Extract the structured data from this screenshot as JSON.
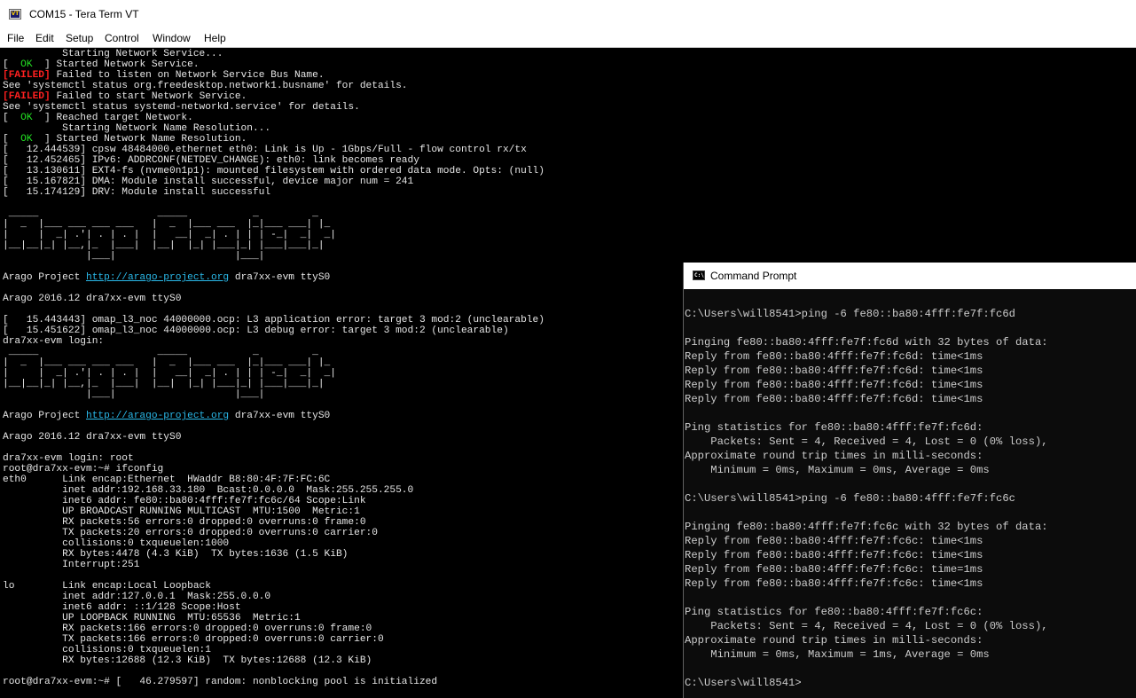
{
  "teraterm": {
    "title": "COM15 - Tera Term VT",
    "icon_label": "VT",
    "menu": [
      "File",
      "Edit",
      "Setup",
      "Control",
      "Window",
      "Help"
    ],
    "lines": [
      [
        {
          "t": "          Starting Network Service..."
        }
      ],
      [
        {
          "t": "[  "
        },
        {
          "t": "OK",
          "c": "ok"
        },
        {
          "t": "  ] Started Network Service."
        }
      ],
      [
        {
          "t": "[",
          "c": "failed"
        },
        {
          "t": "FAILED",
          "c": "failed"
        },
        {
          "t": "]",
          "c": "failed"
        },
        {
          "t": " Failed to listen on Network Service Bus Name."
        }
      ],
      [
        {
          "t": "See 'systemctl status org.freedesktop.network1.busname' for details."
        }
      ],
      [
        {
          "t": "[",
          "c": "failed"
        },
        {
          "t": "FAILED",
          "c": "failed"
        },
        {
          "t": "]",
          "c": "failed"
        },
        {
          "t": " Failed to start Network Service."
        }
      ],
      [
        {
          "t": "See 'systemctl status systemd-networkd.service' for details."
        }
      ],
      [
        {
          "t": "[  "
        },
        {
          "t": "OK",
          "c": "ok"
        },
        {
          "t": "  ] Reached target Network."
        }
      ],
      [
        {
          "t": "          Starting Network Name Resolution..."
        }
      ],
      [
        {
          "t": "[  "
        },
        {
          "t": "OK",
          "c": "ok"
        },
        {
          "t": "  ] Started Network Name Resolution."
        }
      ],
      [
        {
          "t": "[   12.444539] cpsw 48484000.ethernet eth0: Link is Up - 1Gbps/Full - flow control rx/tx"
        }
      ],
      [
        {
          "t": "[   12.452465] IPv6: ADDRCONF(NETDEV_CHANGE): eth0: link becomes ready"
        }
      ],
      [
        {
          "t": "[   13.130611] EXT4-fs (nvme0n1p1): mounted filesystem with ordered data mode. Opts: (null)"
        }
      ],
      [
        {
          "t": "[   15.167821] DMA: Module install successful, device major num = 241"
        }
      ],
      [
        {
          "t": "[   15.174129] DRV: Module install successful"
        }
      ],
      [
        {
          "t": ""
        }
      ],
      [
        {
          "t": " _____                    _____           _         _"
        }
      ],
      [
        {
          "t": "|  _  |___ ___ ___ ___   |  _  |___ ___  |_|___ ___| |_"
        }
      ],
      [
        {
          "t": "|     |  _| .'| . | . |  |   __|  _| . | | | -_|  _|  _|"
        }
      ],
      [
        {
          "t": "|__|__|_| |__,|_  |___|  |__|  |_| |___|_| |___|___|_|"
        }
      ],
      [
        {
          "t": "              |___|                    |___|"
        }
      ],
      [
        {
          "t": ""
        }
      ],
      [
        {
          "t": "Arago Project "
        },
        {
          "t": "http://arago-project.org",
          "c": "url"
        },
        {
          "t": " dra7xx-evm ttyS0"
        }
      ],
      [
        {
          "t": ""
        }
      ],
      [
        {
          "t": "Arago 2016.12 dra7xx-evm ttyS0"
        }
      ],
      [
        {
          "t": ""
        }
      ],
      [
        {
          "t": "[   15.443443] omap_l3_noc 44000000.ocp: L3 application error: target 3 mod:2 (unclearable)"
        }
      ],
      [
        {
          "t": "[   15.451622] omap_l3_noc 44000000.ocp: L3 debug error: target 3 mod:2 (unclearable)"
        }
      ],
      [
        {
          "t": "dra7xx-evm login:"
        }
      ],
      [
        {
          "t": " _____                    _____           _         _"
        }
      ],
      [
        {
          "t": "|  _  |___ ___ ___ ___   |  _  |___ ___  |_|___ ___| |_"
        }
      ],
      [
        {
          "t": "|     |  _| .'| . | . |  |   __|  _| . | | | -_|  _|  _|"
        }
      ],
      [
        {
          "t": "|__|__|_| |__,|_  |___|  |__|  |_| |___|_| |___|___|_|"
        }
      ],
      [
        {
          "t": "              |___|                    |___|"
        }
      ],
      [
        {
          "t": ""
        }
      ],
      [
        {
          "t": "Arago Project "
        },
        {
          "t": "http://arago-project.org",
          "c": "url"
        },
        {
          "t": " dra7xx-evm ttyS0"
        }
      ],
      [
        {
          "t": ""
        }
      ],
      [
        {
          "t": "Arago 2016.12 dra7xx-evm ttyS0"
        }
      ],
      [
        {
          "t": ""
        }
      ],
      [
        {
          "t": "dra7xx-evm login: root"
        }
      ],
      [
        {
          "t": "root@dra7xx-evm:~# ifconfig"
        }
      ],
      [
        {
          "t": "eth0      Link encap:Ethernet  HWaddr B8:80:4F:7F:FC:6C"
        }
      ],
      [
        {
          "t": "          inet addr:192.168.33.180  Bcast:0.0.0.0  Mask:255.255.255.0"
        }
      ],
      [
        {
          "t": "          inet6 addr: fe80::ba80:4fff:fe7f:fc6c/64 Scope:Link"
        }
      ],
      [
        {
          "t": "          UP BROADCAST RUNNING MULTICAST  MTU:1500  Metric:1"
        }
      ],
      [
        {
          "t": "          RX packets:56 errors:0 dropped:0 overruns:0 frame:0"
        }
      ],
      [
        {
          "t": "          TX packets:20 errors:0 dropped:0 overruns:0 carrier:0"
        }
      ],
      [
        {
          "t": "          collisions:0 txqueuelen:1000"
        }
      ],
      [
        {
          "t": "          RX bytes:4478 (4.3 KiB)  TX bytes:1636 (1.5 KiB)"
        }
      ],
      [
        {
          "t": "          Interrupt:251"
        }
      ],
      [
        {
          "t": ""
        }
      ],
      [
        {
          "t": "lo        Link encap:Local Loopback"
        }
      ],
      [
        {
          "t": "          inet addr:127.0.0.1  Mask:255.0.0.0"
        }
      ],
      [
        {
          "t": "          inet6 addr: ::1/128 Scope:Host"
        }
      ],
      [
        {
          "t": "          UP LOOPBACK RUNNING  MTU:65536  Metric:1"
        }
      ],
      [
        {
          "t": "          RX packets:166 errors:0 dropped:0 overruns:0 frame:0"
        }
      ],
      [
        {
          "t": "          TX packets:166 errors:0 dropped:0 overruns:0 carrier:0"
        }
      ],
      [
        {
          "t": "          collisions:0 txqueuelen:1"
        }
      ],
      [
        {
          "t": "          RX bytes:12688 (12.3 KiB)  TX bytes:12688 (12.3 KiB)"
        }
      ],
      [
        {
          "t": ""
        }
      ],
      [
        {
          "t": "root@dra7xx-evm:~# [   46.279597] random: nonblocking pool is initialized"
        }
      ]
    ]
  },
  "cmd": {
    "title": "Command Prompt",
    "icon_label": "C:\\",
    "lines": [
      "",
      "C:\\Users\\will8541>ping -6 fe80::ba80:4fff:fe7f:fc6d",
      "",
      "Pinging fe80::ba80:4fff:fe7f:fc6d with 32 bytes of data:",
      "Reply from fe80::ba80:4fff:fe7f:fc6d: time<1ms",
      "Reply from fe80::ba80:4fff:fe7f:fc6d: time<1ms",
      "Reply from fe80::ba80:4fff:fe7f:fc6d: time<1ms",
      "Reply from fe80::ba80:4fff:fe7f:fc6d: time<1ms",
      "",
      "Ping statistics for fe80::ba80:4fff:fe7f:fc6d:",
      "    Packets: Sent = 4, Received = 4, Lost = 0 (0% loss),",
      "Approximate round trip times in milli-seconds:",
      "    Minimum = 0ms, Maximum = 0ms, Average = 0ms",
      "",
      "C:\\Users\\will8541>ping -6 fe80::ba80:4fff:fe7f:fc6c",
      "",
      "Pinging fe80::ba80:4fff:fe7f:fc6c with 32 bytes of data:",
      "Reply from fe80::ba80:4fff:fe7f:fc6c: time<1ms",
      "Reply from fe80::ba80:4fff:fe7f:fc6c: time<1ms",
      "Reply from fe80::ba80:4fff:fe7f:fc6c: time=1ms",
      "Reply from fe80::ba80:4fff:fe7f:fc6c: time<1ms",
      "",
      "Ping statistics for fe80::ba80:4fff:fe7f:fc6c:",
      "    Packets: Sent = 4, Received = 4, Lost = 0 (0% loss),",
      "Approximate round trip times in milli-seconds:",
      "    Minimum = 0ms, Maximum = 1ms, Average = 0ms",
      "",
      "C:\\Users\\will8541>"
    ]
  }
}
